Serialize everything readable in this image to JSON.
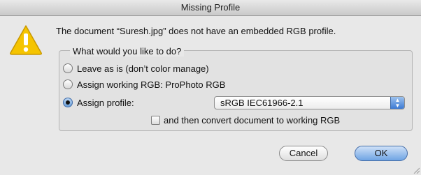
{
  "window": {
    "title": "Missing Profile"
  },
  "icons": {
    "warning": "warning-triangle-icon",
    "popup_arrows": "up-down-arrows-icon",
    "resize": "resize-grip-icon"
  },
  "message": "The document “Suresh.jpg” does not have an embedded RGB profile.",
  "options": {
    "group_label": "What would you like to do?",
    "leave": {
      "label": "Leave as is (don’t color manage)",
      "selected": false
    },
    "assign_working": {
      "label": "Assign working RGB:  ProPhoto RGB",
      "selected": false
    },
    "assign_profile": {
      "label": "Assign profile:",
      "selected": true,
      "value": "sRGB IEC61966-2.1"
    },
    "convert": {
      "label": "and then convert document to working RGB",
      "checked": false
    }
  },
  "buttons": {
    "cancel": "Cancel",
    "ok": "OK"
  },
  "colors": {
    "accent": "#6fa4e4",
    "warning": "#f5c400"
  }
}
